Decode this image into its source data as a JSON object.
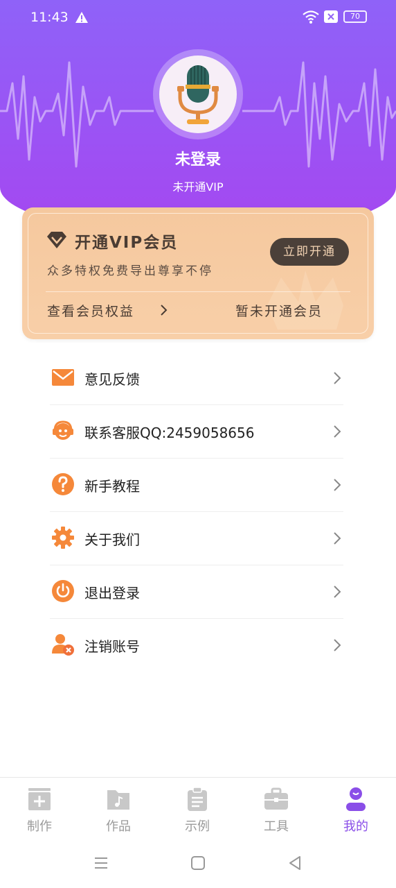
{
  "status_bar": {
    "time": "11:43",
    "battery": "70"
  },
  "profile": {
    "name": "未登录",
    "vip_status": "未开通VIP"
  },
  "vip_card": {
    "title": "开通VIP会员",
    "description": "众多特权免费导出尊享不停",
    "button_label": "立即开通",
    "benefits_link": "查看会员权益",
    "membership_status": "暂未开通会员"
  },
  "menu": [
    {
      "label": "意见反馈",
      "icon": "mail-icon"
    },
    {
      "label": "联系客服QQ:2459058656",
      "icon": "headset-icon"
    },
    {
      "label": "新手教程",
      "icon": "question-icon"
    },
    {
      "label": "关于我们",
      "icon": "gear-icon"
    },
    {
      "label": "退出登录",
      "icon": "power-icon"
    },
    {
      "label": "注销账号",
      "icon": "user-remove-icon"
    }
  ],
  "tabs": [
    {
      "label": "制作",
      "icon": "add-box-icon",
      "active": false
    },
    {
      "label": "作品",
      "icon": "music-folder-icon",
      "active": false
    },
    {
      "label": "示例",
      "icon": "clipboard-icon",
      "active": false
    },
    {
      "label": "工具",
      "icon": "toolbox-icon",
      "active": false
    },
    {
      "label": "我的",
      "icon": "profile-icon",
      "active": true
    }
  ],
  "colors": {
    "brand_purple": "#9b53f4",
    "active_tab": "#8a4ee8",
    "icon_orange": "#f5883a",
    "vip_gold": "#f5c89e"
  }
}
